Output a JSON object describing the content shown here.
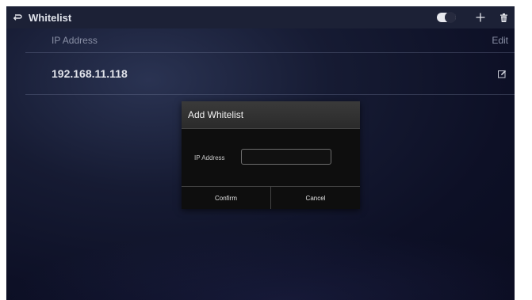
{
  "header": {
    "title": "Whitelist",
    "back_icon": "return-arrow-icon",
    "toggle_state": "off",
    "add_icon": "plus-icon",
    "delete_icon": "trash-icon"
  },
  "table": {
    "columns": {
      "ip": "IP Address",
      "edit": "Edit"
    },
    "rows": [
      {
        "ip": "192.168.11.118",
        "edit_icon": "edit-icon"
      }
    ]
  },
  "dialog": {
    "title": "Add Whitelist",
    "field_label": "IP Address",
    "field_value": "",
    "confirm_label": "Confirm",
    "cancel_label": "Cancel"
  },
  "colors": {
    "topbar": "#1c2136",
    "background": "#0d1026",
    "dialog_header": "#333333",
    "dialog_body": "#0e0e0e"
  }
}
